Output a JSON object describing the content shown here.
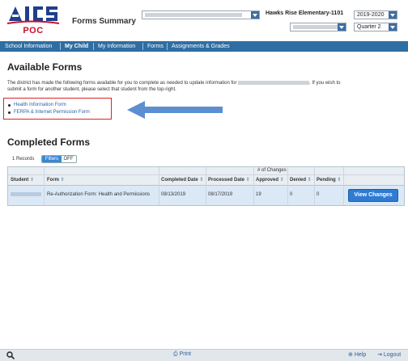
{
  "header": {
    "logo_text": "POC",
    "title": "Forms Summary",
    "school": "Hawks Rise Elementary-1101",
    "year": "2019-2020",
    "term": "Quarter 2"
  },
  "nav": {
    "items": [
      "School Information",
      "My Child",
      "My Information",
      "Forms",
      "Assignments & Grades"
    ]
  },
  "available": {
    "heading": "Available Forms",
    "desc_part1": "The district has made the following forms available for you to complete as needed to update information for",
    "desc_part2": ". If you wish to",
    "desc_line2": "submit a form for another student, please select that student from the top-right.",
    "forms": [
      "Health Information Form",
      "FERPA & Internet Permission Form"
    ]
  },
  "completed": {
    "heading": "Completed Forms",
    "records": "1 Records",
    "filter_on": "Filters",
    "filter_off": "OFF",
    "group_label": "# of Changes",
    "columns": [
      "Student",
      "Form",
      "Completed Date",
      "Processed Date",
      "Approved",
      "Denied",
      "Pending"
    ],
    "row": {
      "form": "Re-Authorization Form: Health and Permissions",
      "completed": "08/13/2019",
      "processed": "08/17/2019",
      "approved": "19",
      "denied": "0",
      "pending": "0"
    },
    "button": "View Changes"
  },
  "footer": {
    "print": "Print",
    "help": "Help",
    "logout": "Logout"
  },
  "colors": {
    "nav": "#2f6ea3",
    "accent_button": "#2f7bd3",
    "highlight_box": "#dd2222",
    "arrow": "#5b8fd1"
  }
}
